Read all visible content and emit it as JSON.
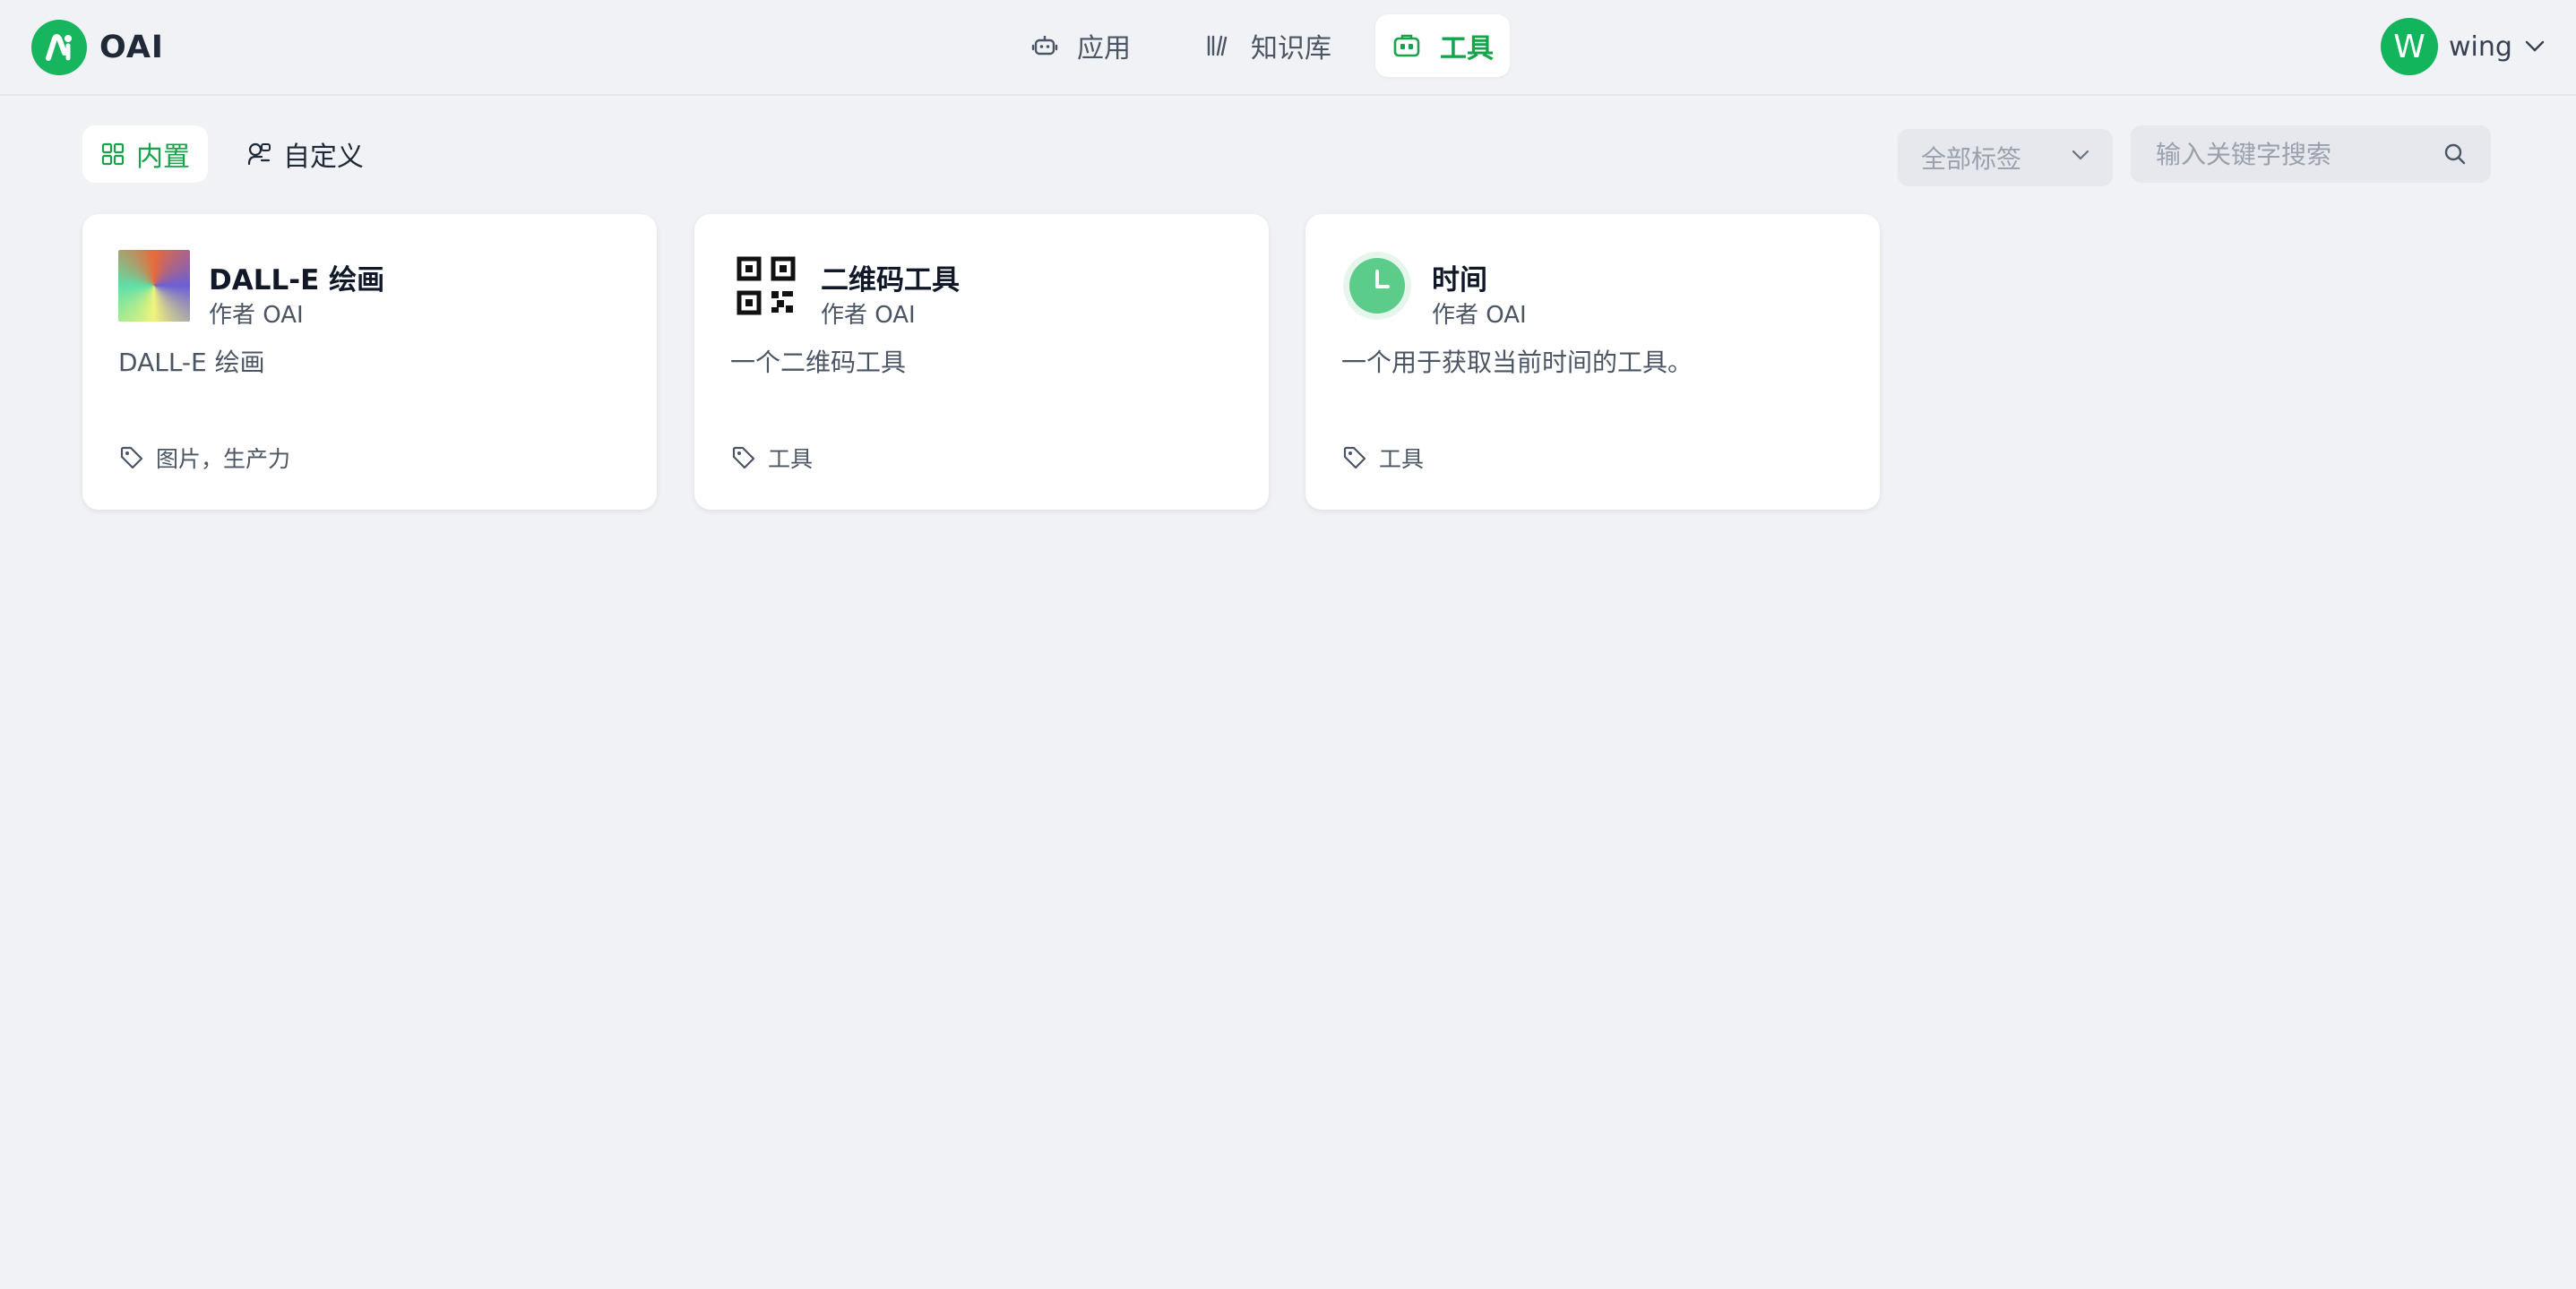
{
  "brand": {
    "name": "OAI",
    "color": "#16b55e"
  },
  "nav": {
    "items": [
      {
        "label": "应用",
        "icon": "robot-icon"
      },
      {
        "label": "知识库",
        "icon": "books-icon"
      },
      {
        "label": "工具",
        "icon": "toolbox-icon",
        "active": true
      }
    ]
  },
  "user": {
    "initial": "W",
    "name": "wing"
  },
  "toolbar": {
    "segments": [
      {
        "label": "内置",
        "icon": "grid-icon",
        "active": true
      },
      {
        "label": "自定义",
        "icon": "custom-plugin-icon"
      }
    ],
    "tag_filter": {
      "value": "全部标签"
    },
    "search": {
      "placeholder": "输入关键字搜索",
      "value": ""
    }
  },
  "cards": [
    {
      "title": "DALL-E 绘画",
      "author": "作者 OAI",
      "description": "DALL-E 绘画",
      "tags": "图片，生产力",
      "icon": "dalle-gradient-icon"
    },
    {
      "title": "二维码工具",
      "author": "作者 OAI",
      "description": "一个二维码工具",
      "tags": "工具",
      "icon": "qr-code-icon"
    },
    {
      "title": "时间",
      "author": "作者 OAI",
      "description": "一个用于获取当前时间的工具。",
      "tags": "工具",
      "icon": "clock-icon"
    }
  ],
  "colors": {
    "accent": "#16a34a",
    "background": "#f0f2f6",
    "card": "#ffffff"
  }
}
